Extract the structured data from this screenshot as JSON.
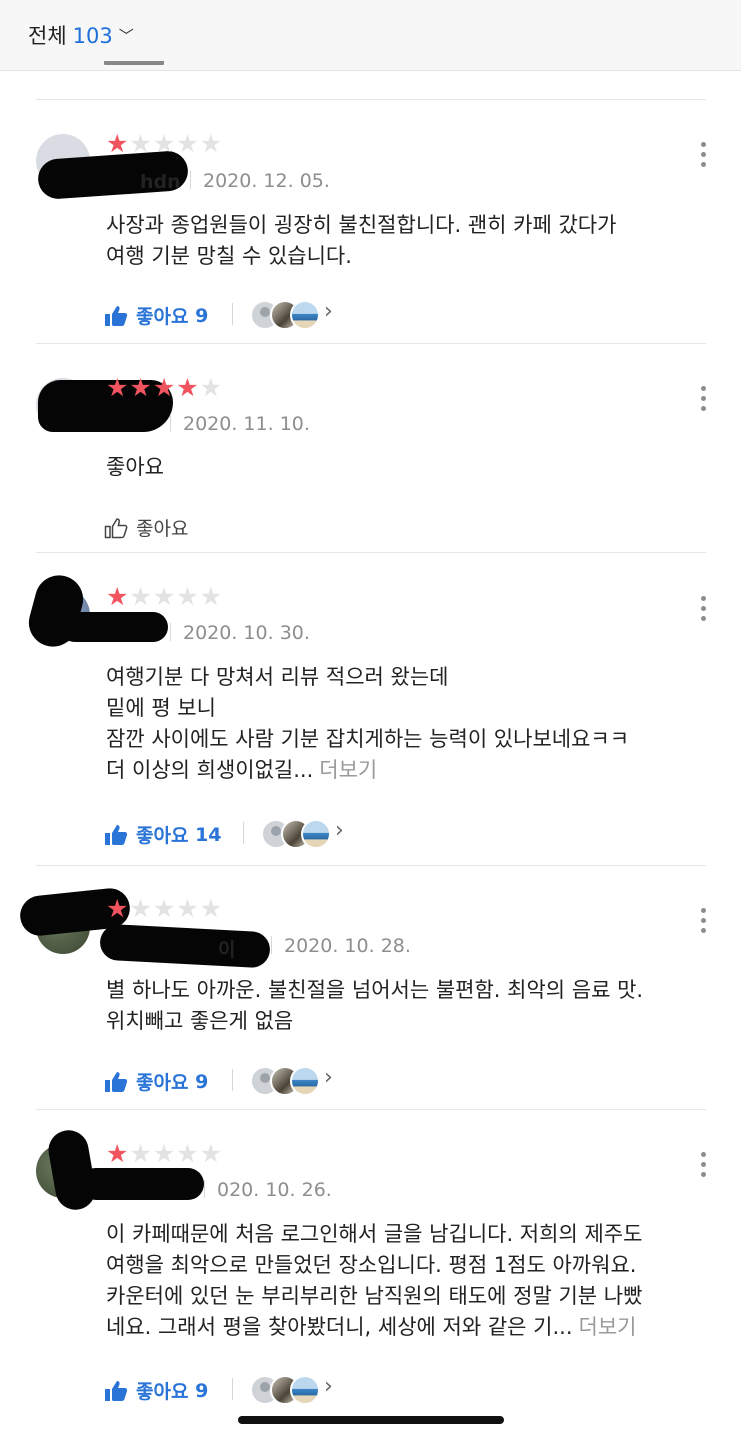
{
  "header": {
    "filter_label": "전체",
    "count": "103",
    "chevron_icon": "chevron-down-icon"
  },
  "colors": {
    "accent": "#1e6fd9",
    "star": "#f0545f",
    "like_blue": "#2a74d8"
  },
  "reviews": [
    {
      "stars": "★",
      "stars_off": "★★★★",
      "rating": 1,
      "username_visible": "hdn",
      "date": "2020. 12. 05.",
      "lines": [
        "사장과 종업원들이 굉장히 불친절합니다.  괜히 카페 갔다가",
        "여행 기분 망칠 수 있습니다."
      ],
      "more_label": "",
      "like_label": "좋아요",
      "like_count": "9"
    },
    {
      "stars": "★★★★",
      "stars_off": "★",
      "rating": 4,
      "username_visible": "",
      "date": "2020. 11. 10.",
      "lines": [
        "좋아요"
      ],
      "more_label": "",
      "like_label": "좋아요",
      "like_count": ""
    },
    {
      "stars": "★",
      "stars_off": "★★★★",
      "rating": 1,
      "username_visible": "",
      "date": "2020. 10. 30.",
      "lines": [
        "여행기분 다 망쳐서 리뷰 적으러 왔는데",
        "밑에 평 보니",
        "잠깐 사이에도 사람 기분 잡치게하는 능력이 있나보네요ㅋㅋ",
        "더 이상의 희생이없길..."
      ],
      "more_label": "더보기",
      "like_label": "좋아요",
      "like_count": "14"
    },
    {
      "stars": "★",
      "stars_off": "★★★★",
      "rating": 1,
      "username_visible": "이",
      "date": "2020. 10. 28.",
      "lines": [
        "별 하나도 아까운. 불친절을 넘어서는 불편함. 최악의 음료 맛.",
        "위치빼고 좋은게 없음"
      ],
      "more_label": "",
      "like_label": "좋아요",
      "like_count": "9"
    },
    {
      "stars": "★",
      "stars_off": "★★★★",
      "rating": 1,
      "username_visible": "",
      "date": "020. 10. 26.",
      "lines": [
        "이 카페때문에 처음 로그인해서 글을 남깁니다. 저희의 제주도",
        "여행을 최악으로 만들었던 장소입니다. 평점 1점도 아까워요.",
        "카운터에 있던 눈 부리부리한 남직원의 태도에 정말 기분 나빴",
        "네요. 그래서 평을 찾아봤더니, 세상에 저와 같은 기..."
      ],
      "more_label": "더보기",
      "like_label": "좋아요",
      "like_count": "9"
    }
  ]
}
